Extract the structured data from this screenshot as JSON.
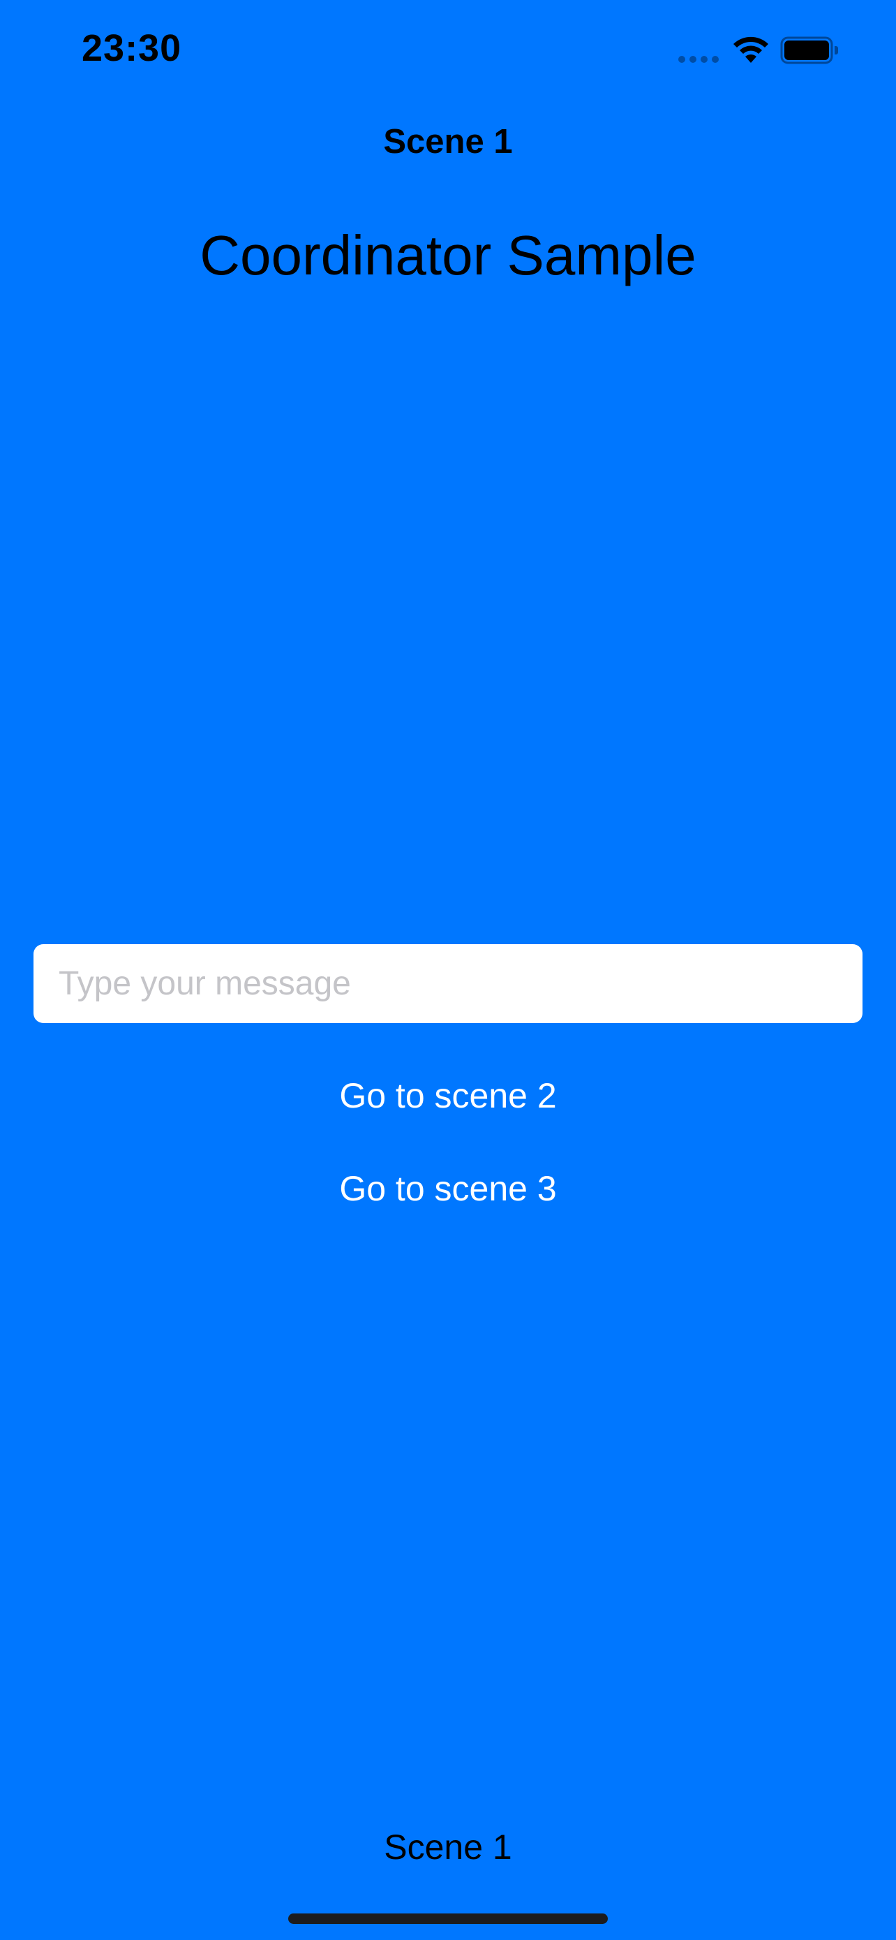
{
  "status_bar": {
    "time": "23:30",
    "icons": [
      "cellular-signal-icon",
      "wifi-icon",
      "battery-icon"
    ]
  },
  "navigation": {
    "title": "Scene 1"
  },
  "main": {
    "title": "Coordinator Sample",
    "message_input": {
      "value": "",
      "placeholder": "Type your message"
    },
    "buttons": {
      "scene2": "Go to scene 2",
      "scene3": "Go to scene 3"
    }
  },
  "footer": {
    "label": "Scene 1"
  },
  "colors": {
    "background": "#0077FF",
    "button_text": "#FFFFFF",
    "input_background": "#FFFFFF",
    "placeholder": "#C4C4C8"
  }
}
